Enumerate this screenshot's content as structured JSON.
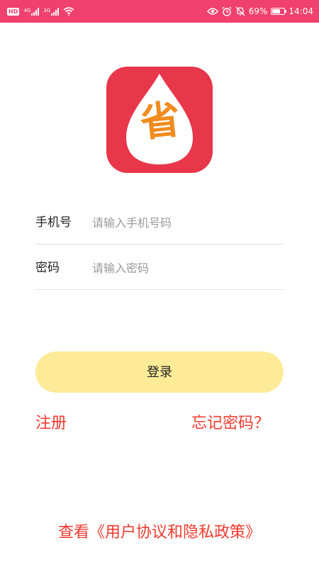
{
  "status_bar": {
    "hd_label": "HD",
    "net1_label": "4G",
    "net2_label": "3G",
    "battery_percent_text": "69%",
    "battery_level": 0.69,
    "time": "14:04",
    "icons": [
      "hd-icon",
      "signal-icon",
      "wifi-icon",
      "eye-icon",
      "alarm-icon",
      "mute-icon",
      "battery-icon"
    ]
  },
  "logo": {
    "char": "省",
    "colors": {
      "bg": "#e8364b",
      "drop": "#ffffff",
      "char": "#f08c1e"
    }
  },
  "form": {
    "phone_label": "手机号",
    "phone_placeholder": "请输入手机号码",
    "phone_value": "",
    "password_label": "密码",
    "password_placeholder": "请输入密码",
    "password_value": ""
  },
  "buttons": {
    "login": "登录",
    "register": "注册",
    "forgot_password": "忘记密码？"
  },
  "policy_link": "查看《用户协议和隐私政策》",
  "colors": {
    "status_bar": "#f0406e",
    "login_button": "#fdeb98",
    "link": "#f23a2e"
  }
}
